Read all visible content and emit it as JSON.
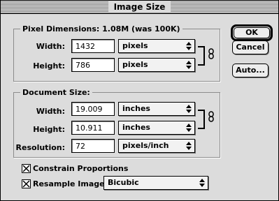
{
  "window": {
    "title": "Image Size"
  },
  "pixel_dimensions": {
    "group_label": "Pixel Dimensions:  1.08M (was 100K)",
    "width_label": "Width:",
    "width_value": "1432",
    "width_unit": "pixels",
    "height_label": "Height:",
    "height_value": "786",
    "height_unit": "pixels"
  },
  "document_size": {
    "group_label": "Document Size:",
    "width_label": "Width:",
    "width_value": "19.009",
    "width_unit": "inches",
    "height_label": "Height:",
    "height_value": "10.911",
    "height_unit": "inches",
    "resolution_label": "Resolution:",
    "resolution_value": "72",
    "resolution_unit": "pixels/inch"
  },
  "options": {
    "constrain_label": "Constrain Proportions",
    "constrain_checked": true,
    "resample_label": "Resample Image:",
    "resample_checked": true,
    "resample_method": "Bicubic"
  },
  "buttons": {
    "ok": "OK",
    "cancel": "Cancel",
    "auto": "Auto..."
  },
  "icons": {
    "link": "chain-link-icon",
    "popup_arrow": "updown-arrows-icon",
    "check": "check-mark-icon"
  }
}
